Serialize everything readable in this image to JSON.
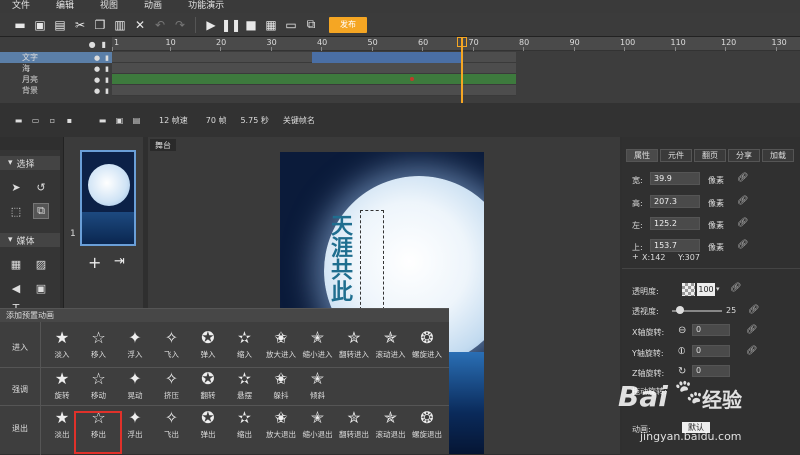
{
  "menubar": {
    "items": [
      "文件",
      "编辑",
      "视图",
      "动画",
      "功能演示"
    ]
  },
  "toolbar": {
    "icons": [
      "new-icon",
      "open-icon",
      "save-icon",
      "cut-icon",
      "copy-icon",
      "paste-icon",
      "delete-icon",
      "undo-icon",
      "redo-icon",
      "play-icon",
      "pause-icon",
      "stop-icon",
      "qrcode-icon",
      "preview-icon",
      "export-icon"
    ],
    "publish_label": "发布",
    "accent": "#f5a623"
  },
  "timeline": {
    "ticks": [
      "1",
      "10",
      "20",
      "30",
      "40",
      "50",
      "60",
      "70",
      "80",
      "90",
      "100",
      "110",
      "120",
      "130"
    ],
    "layers": [
      {
        "name": "文字",
        "selected": true
      },
      {
        "name": "海",
        "selected": false
      },
      {
        "name": "月亮",
        "selected": false
      },
      {
        "name": "背景",
        "selected": false
      }
    ],
    "track_colors": {
      "text": "#4a6fa5",
      "moon": "#3d7a3d",
      "empty": "#4d4d4d"
    },
    "playhead_frame": 70,
    "footer": {
      "fps": "12 帧速",
      "frames": "70 帧",
      "seconds": "5.75 秒",
      "keyframe_name_label": "关键帧名"
    }
  },
  "leftpanel": {
    "select_section": "选择",
    "media_section": "媒体"
  },
  "thumbs": {
    "page_number": "1"
  },
  "stage": {
    "tab_label": "舞台",
    "poem_text": "天涯共此"
  },
  "rightpanel": {
    "tabs": [
      "属性",
      "元件",
      "翻页",
      "分享",
      "加载"
    ],
    "props": [
      {
        "label": "宽:",
        "value": "39.9",
        "unit": "像素"
      },
      {
        "label": "高:",
        "value": "207.3",
        "unit": "像素"
      },
      {
        "label": "左:",
        "value": "125.2",
        "unit": "像素"
      },
      {
        "label": "上:",
        "value": "153.7",
        "unit": "像素"
      }
    ],
    "coords": "X:142     Y:307",
    "opacity_label": "透明度:",
    "opacity_value": "100",
    "blur_label": "透视度:",
    "blur_value": "25",
    "x_rot_label": "X轴旋转:",
    "y_rot_label": "Y轴旋转:",
    "z_rot_label": "Z轴旋转:",
    "rot_value": "0",
    "drag_label": "拖动旋转:",
    "sync_label": "动画:",
    "sync_value": "默认"
  },
  "anim_popup": {
    "title": "添加预置动画",
    "rows": [
      {
        "label": "进入",
        "effects": [
          "淡入",
          "移入",
          "浮入",
          "飞入",
          "弹入",
          "缩入",
          "放大进入",
          "缩小进入",
          "翻转进入",
          "滚动进入",
          "螺旋进入"
        ]
      },
      {
        "label": "强调",
        "effects": [
          "旋转",
          "移动",
          "晃动",
          "挤压",
          "翻转",
          "悬摆",
          "躲抖",
          "倾斜"
        ]
      },
      {
        "label": "退出",
        "effects": [
          "淡出",
          "移出",
          "浮出",
          "飞出",
          "弹出",
          "缩出",
          "放大退出",
          "缩小退出",
          "翻转退出",
          "滚动退出",
          "螺旋退出"
        ]
      }
    ],
    "selected_effect": "移出"
  },
  "watermark": {
    "brand": "Bai",
    "brand2": "经验",
    "url": "jingyan.baidu.com"
  }
}
